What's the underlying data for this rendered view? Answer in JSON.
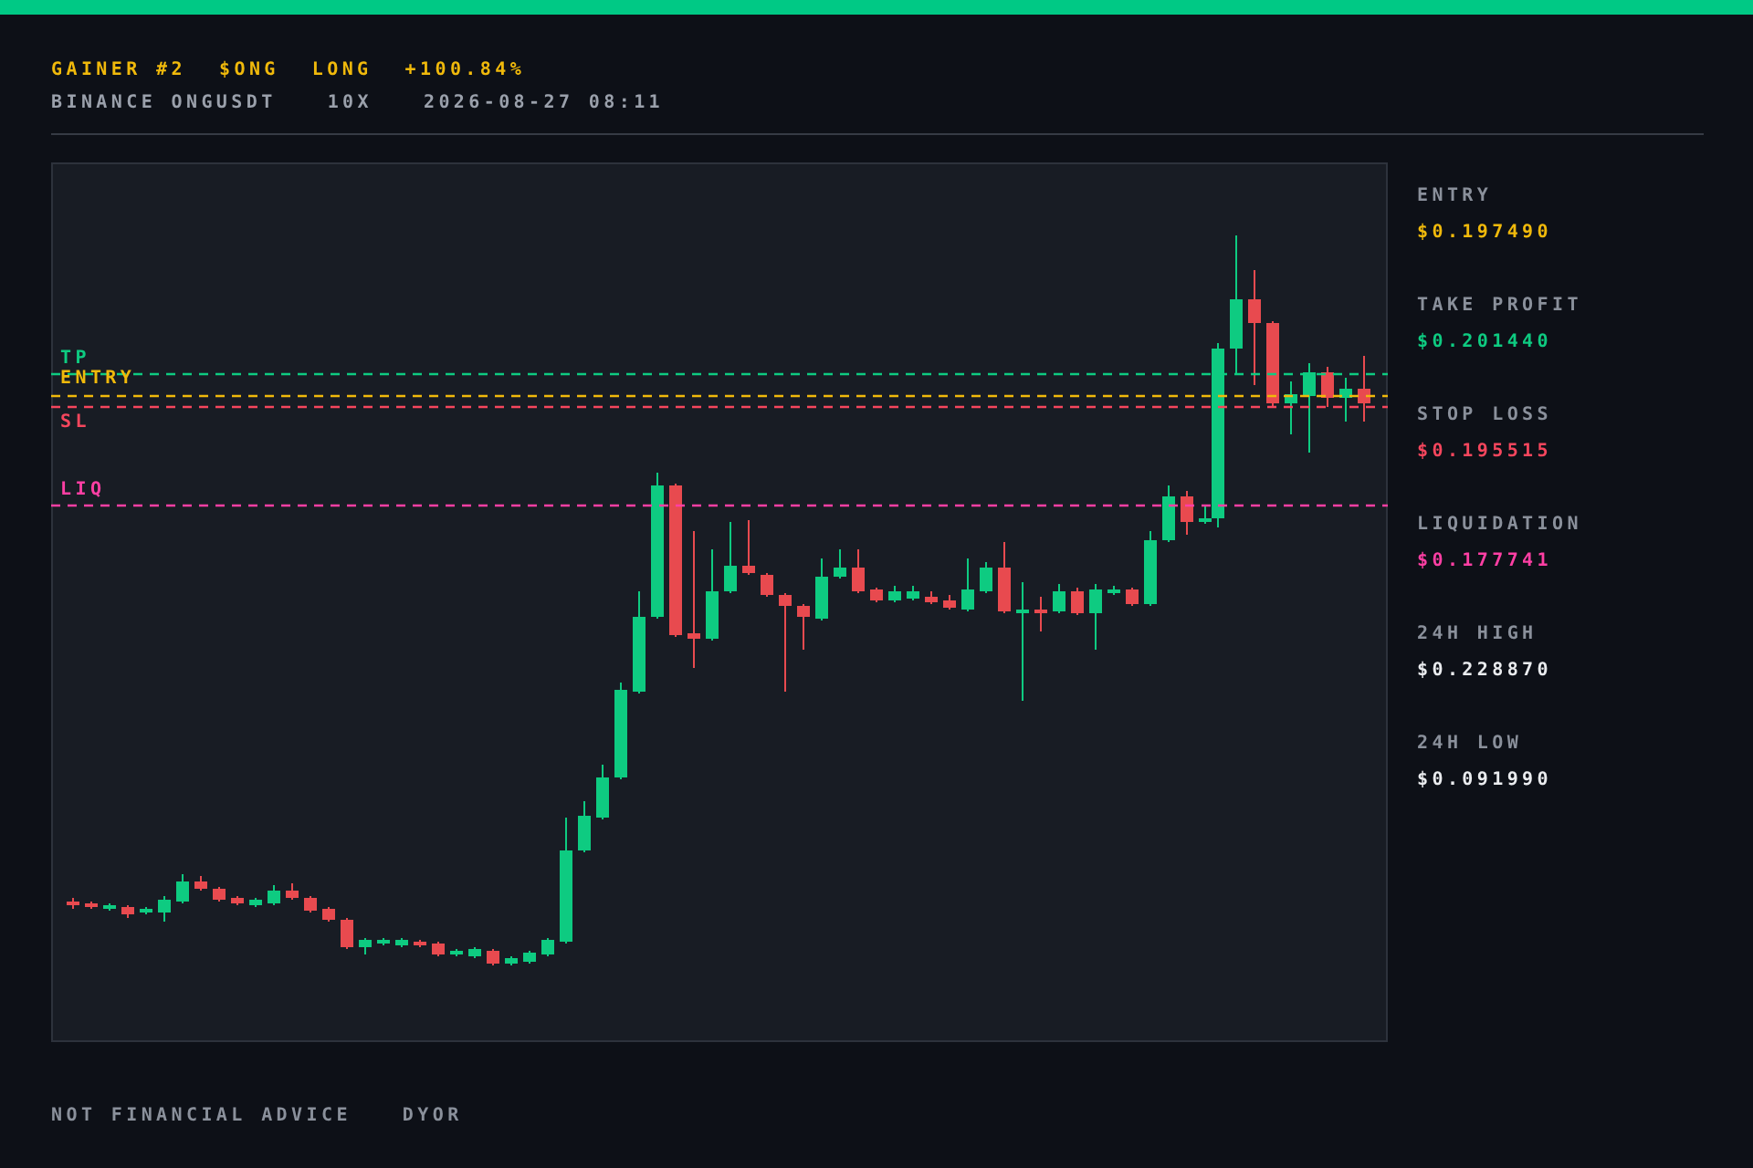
{
  "header": {
    "title": [
      "GAINER #2",
      "$ONG",
      "LONG",
      "+100.84%"
    ],
    "subtitle": [
      "BINANCE ONGUSDT",
      "10X",
      "2026-08-27 08:11"
    ]
  },
  "chart": {
    "levels": [
      {
        "label": "TP",
        "color": "#0ecb81"
      },
      {
        "label": "ENTRY",
        "color": "#f0b90b"
      },
      {
        "label": "SL",
        "color": "#f6465d"
      },
      {
        "label": "LIQ",
        "color": "#ff3fa4"
      }
    ]
  },
  "stats": [
    {
      "label": "ENTRY",
      "value": "$0.197490",
      "color": "#f0b90b"
    },
    {
      "label": "TAKE PROFIT",
      "value": "$0.201440",
      "color": "#0ecb81"
    },
    {
      "label": "STOP LOSS",
      "value": "$0.195515",
      "color": "#f6465d"
    },
    {
      "label": "LIQUIDATION",
      "value": "$0.177741",
      "color": "#ff3fa4"
    },
    {
      "label": "24H HIGH",
      "value": "$0.228870",
      "color": "#eaecef"
    },
    {
      "label": "24H LOW",
      "value": "$0.091990",
      "color": "#eaecef"
    }
  ],
  "footer": [
    "NOT FINANCIAL ADVICE",
    "DYOR"
  ]
}
